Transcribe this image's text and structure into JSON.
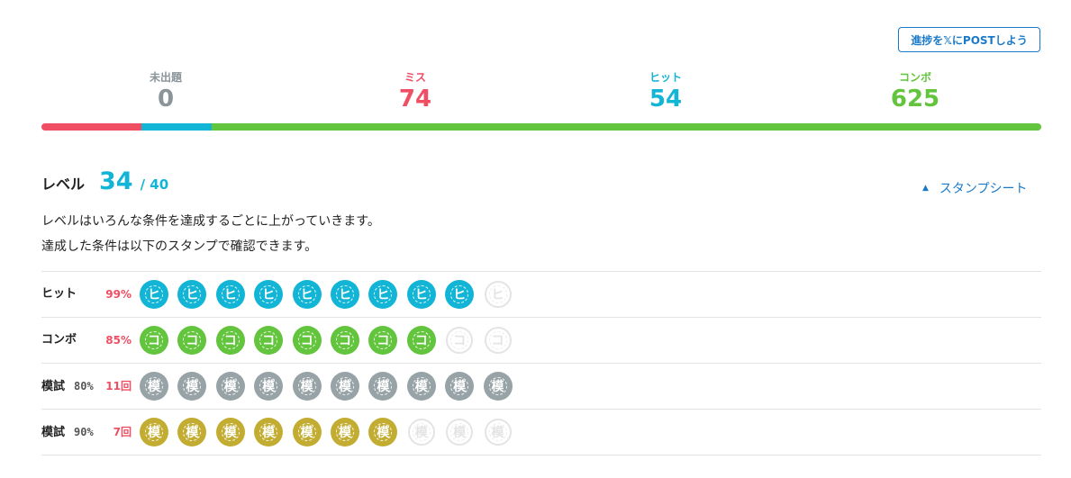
{
  "share_button": "進捗を𝕏にPOSTしよう",
  "stats": [
    {
      "label": "未出題",
      "value": "0",
      "color": "#8a9499"
    },
    {
      "label": "ミス",
      "value": "74",
      "color": "#f04e63"
    },
    {
      "label": "ヒット",
      "value": "54",
      "color": "#12b5d6"
    },
    {
      "label": "コンボ",
      "value": "625",
      "color": "#63c43d"
    }
  ],
  "progress_bar": [
    {
      "name": "miss",
      "fraction": 0.1,
      "color": "#f04e63"
    },
    {
      "name": "hit",
      "fraction": 0.07,
      "color": "#12b5d6"
    },
    {
      "name": "combo",
      "fraction": 0.83,
      "color": "#63c43d"
    }
  ],
  "level": {
    "label": "レベル",
    "value": "34",
    "max": "/ 40"
  },
  "stamp_sheet_toggle": {
    "icon": "caret-up-icon",
    "label": "スタンプシート"
  },
  "description": [
    "レベルはいろんな条件を達成するごとに上がっていきます。",
    "達成した条件は以下のスタンプで確認できます。"
  ],
  "stamp_rows": [
    {
      "label": "ヒット",
      "threshold": "",
      "value": "99%",
      "glyph": "ヒ",
      "color": "#12b5d6",
      "earned": 9,
      "total": 10
    },
    {
      "label": "コンボ",
      "threshold": "",
      "value": "85%",
      "glyph": "コ",
      "color": "#63c43d",
      "earned": 8,
      "total": 10
    },
    {
      "label": "模試",
      "threshold": "80%",
      "value": "11回",
      "glyph": "模",
      "color": "#97a3a6",
      "earned": 10,
      "total": 10
    },
    {
      "label": "模試",
      "threshold": "90%",
      "value": "7回",
      "glyph": "模",
      "color": "#c2ad32",
      "earned": 7,
      "total": 10
    }
  ]
}
